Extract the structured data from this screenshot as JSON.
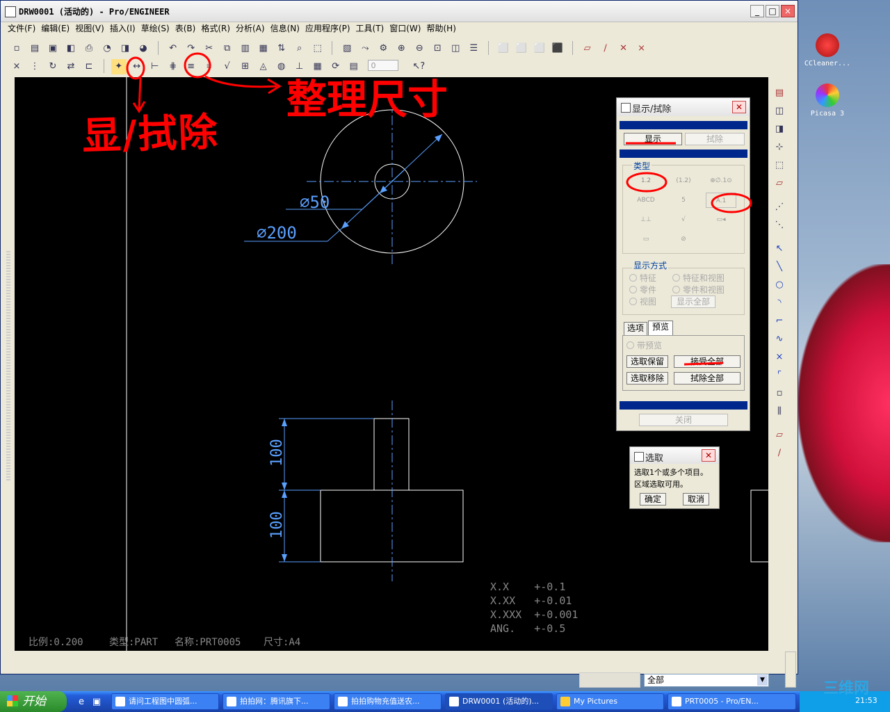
{
  "window": {
    "title": "DRW0001 (活动的) - Pro/ENGINEER",
    "minimize": "_",
    "maximize": "□",
    "close": "×"
  },
  "menu": [
    "文件(F)",
    "编辑(E)",
    "视图(V)",
    "插入(I)",
    "草绘(S)",
    "表(B)",
    "格式(R)",
    "分析(A)",
    "信息(N)",
    "应用程序(P)",
    "工具(T)",
    "窗口(W)",
    "帮助(H)"
  ],
  "toolbar": {
    "row1_icons": [
      "new-icon",
      "open-icon",
      "save-icon",
      "print-icon",
      "cut-icon",
      "copy-icon",
      "paste-icon",
      "undo-icon",
      "redo-icon",
      "zoom-in-icon",
      "zoom-out-icon",
      "refit-icon",
      "repaint-icon"
    ],
    "stepper_value": "0"
  },
  "drawing": {
    "dim_small_circle": "∅50",
    "dim_large_circle": "∅200",
    "dim_upper_height": "100",
    "dim_lower_height": "100",
    "tolerance_lines": [
      "X.X    +-0.1",
      "X.XX   +-0.01",
      "X.XXX  +-0.001",
      "ANG.   +-0.5"
    ],
    "status_scale": "比例:0.200",
    "status_type": "类型:PART",
    "status_name": "名称:PRT0005",
    "status_size": "尺寸:A4"
  },
  "annotations": {
    "show_erase": "显/拭除",
    "clean_dims": "整理尺寸"
  },
  "show_erase_dialog": {
    "title": "显示/拭除",
    "tab_show": "显示",
    "tab_erase": "拭除",
    "type_label": "类型",
    "type_icons": [
      "dimension-icon",
      "ref-dimension-icon",
      "geom-tol-icon",
      "note-icon",
      "balloon-icon",
      "axis-icon",
      "symbol-icon",
      "surface-finish-icon",
      "datum-icon",
      "cosmetic-icon",
      "datum-target-icon"
    ],
    "dim_label": "1.2",
    "ref_dim_label": "(1.2)",
    "geomtol_label": "⊕∅.1⊙",
    "note_label": "ABCD",
    "balloon_label": "5",
    "datum_label": "A.1",
    "display_by_label": "显示方式",
    "radio_feature": "特征",
    "radio_feature_view": "特征和视图",
    "radio_part": "零件",
    "radio_part_view": "零件和视图",
    "radio_view": "视图",
    "show_all": "显示全部",
    "tab_options": "选项",
    "tab_preview": "预览",
    "with_preview": "带预览",
    "select_keep": "选取保留",
    "accept_all": "接受全部",
    "select_remove": "选取移除",
    "erase_all": "拭除全部",
    "close": "关闭"
  },
  "select_dialog": {
    "title": "选取",
    "line1": "选取1个或多个项目。",
    "line2": "区域选取可用。",
    "ok": "确定",
    "cancel": "取消"
  },
  "filter": {
    "value": "全部"
  },
  "desktop_icons": [
    {
      "label": "CCleaner..."
    },
    {
      "label": "Picasa 3"
    }
  ],
  "taskbar": {
    "start": "开始",
    "tasks": [
      "请问工程图中圆弧...",
      "拍拍网：腾讯旗下...",
      "拍拍购物充值送农...",
      "DRW0001 (活动的)...",
      "My Pictures",
      "PRT0005 - Pro/EN..."
    ],
    "clock": "21:53",
    "watermark": "三维网"
  },
  "colors": {
    "dim_blue": "#5aa0ff",
    "annotation_red": "#ff0000",
    "title_blue": "#00288c"
  }
}
